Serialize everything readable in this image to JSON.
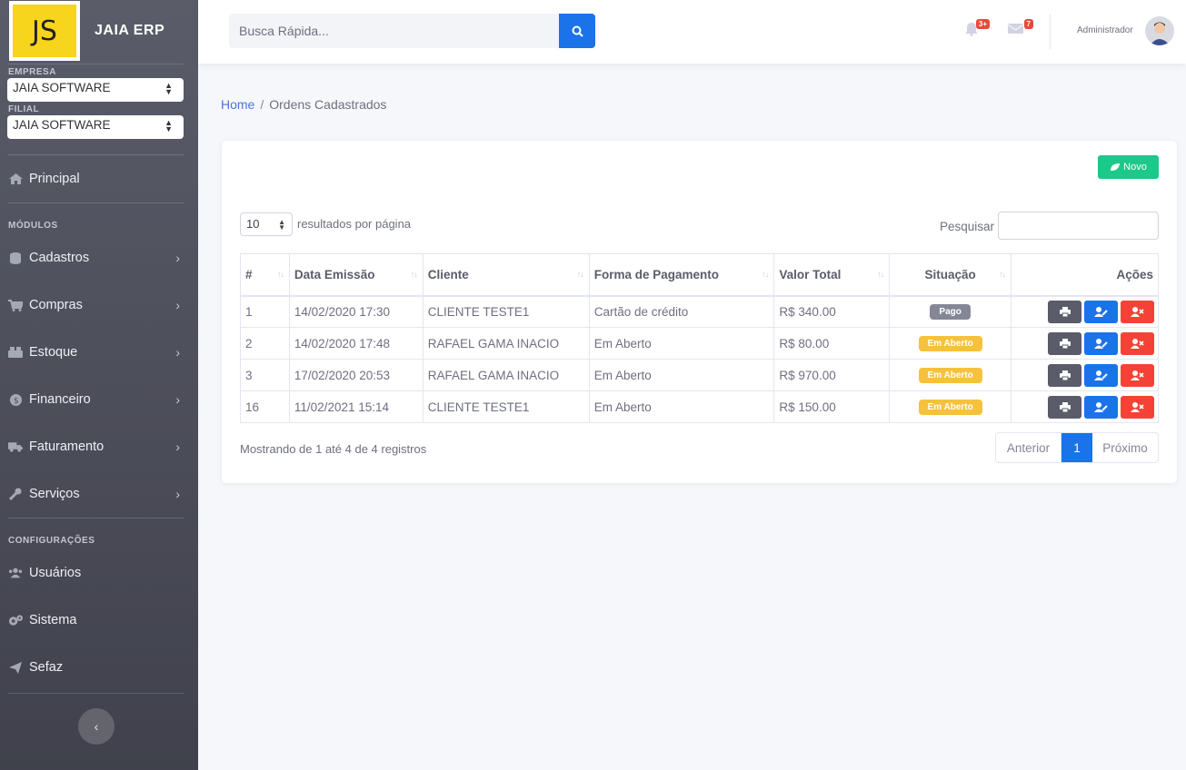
{
  "app": {
    "logo_text": "JS",
    "name": "JAIA ERP"
  },
  "sidebar": {
    "empresa_label": "EMPRESA",
    "empresa_value": "JAIA SOFTWARE",
    "filial_label": "FILIAL",
    "filial_value": "JAIA SOFTWARE",
    "principal": "Principal",
    "modulos_label": "MÓDULOS",
    "modules": [
      {
        "label": "Cadastros",
        "icon": "database-icon"
      },
      {
        "label": "Compras",
        "icon": "cart-icon"
      },
      {
        "label": "Estoque",
        "icon": "boxes-icon"
      },
      {
        "label": "Financeiro",
        "icon": "money-icon"
      },
      {
        "label": "Faturamento",
        "icon": "truck-icon"
      },
      {
        "label": "Serviços",
        "icon": "wrench-icon"
      }
    ],
    "config_label": "CONFIGURAÇÕES",
    "config": [
      {
        "label": "Usuários",
        "icon": "users-icon"
      },
      {
        "label": "Sistema",
        "icon": "cogs-icon"
      },
      {
        "label": "Sefaz",
        "icon": "paper-plane-icon"
      }
    ]
  },
  "topbar": {
    "search_placeholder": "Busca Rápida...",
    "alerts_badge": "3+",
    "messages_badge": "7",
    "username": "Administrador"
  },
  "breadcrumb": {
    "home": "Home",
    "sep": "/",
    "current": "Ordens Cadastrados"
  },
  "card": {
    "novo_label": "Novo",
    "page_length": "10",
    "page_length_label": "resultados por página",
    "search_label": "Pesquisar",
    "columns": [
      "#",
      "Data Emissão",
      "Cliente",
      "Forma de Pagamento",
      "Valor Total",
      "Situação",
      "Ações"
    ],
    "rows": [
      {
        "id": "1",
        "data": "14/02/2020 17:30",
        "cliente": "CLIENTE TESTE1",
        "pagamento": "Cartão de crédito",
        "valor": "R$ 340.00",
        "situacao": "Pago"
      },
      {
        "id": "2",
        "data": "14/02/2020 17:48",
        "cliente": "RAFAEL GAMA INACIO",
        "pagamento": "Em Aberto",
        "valor": "R$ 80.00",
        "situacao": "Em Aberto"
      },
      {
        "id": "3",
        "data": "17/02/2020 20:53",
        "cliente": "RAFAEL GAMA INACIO",
        "pagamento": "Em Aberto",
        "valor": "R$ 970.00",
        "situacao": "Em Aberto"
      },
      {
        "id": "16",
        "data": "11/02/2021 15:14",
        "cliente": "CLIENTE TESTE1",
        "pagamento": "Em Aberto",
        "valor": "R$ 150.00",
        "situacao": "Em Aberto"
      }
    ],
    "info": "Mostrando de 1 até 4 de 4 registros",
    "pager": {
      "prev": "Anterior",
      "current": "1",
      "next": "Próximo"
    }
  },
  "colors": {
    "primary": "#1a73e8",
    "success": "#1cc88a",
    "danger": "#f44336",
    "dark": "#5a5c69",
    "warning": "#f6c23e",
    "secondary": "#858796"
  }
}
